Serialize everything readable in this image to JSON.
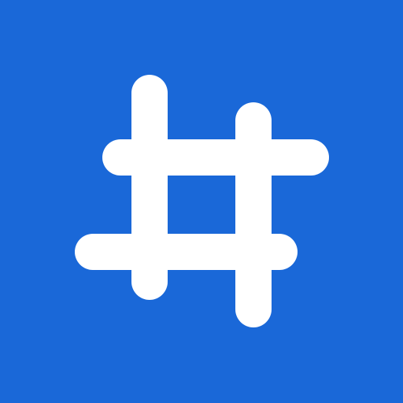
{
  "app_icon": {
    "icon_name": "hashtag-icon",
    "background_color": "#1A68D8",
    "glyph_color": "#FFFFFF"
  }
}
